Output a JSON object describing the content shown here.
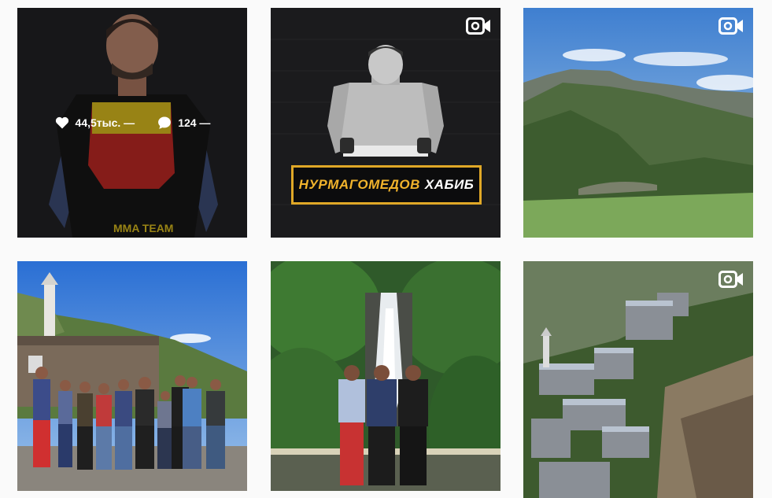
{
  "posts": [
    {
      "type": "photo",
      "hovered": true,
      "stats": {
        "likes": "44,5тыс. —",
        "comments": "124 —"
      }
    },
    {
      "type": "video",
      "banner": {
        "first": "НУРМАГОМЕДОВ",
        "last": "ХАБИБ"
      }
    },
    {
      "type": "video"
    },
    {
      "type": "photo"
    },
    {
      "type": "photo"
    },
    {
      "type": "video"
    }
  ],
  "icons": {
    "like": "heart-icon",
    "comment": "comment-bubble-icon",
    "video": "video-camera-icon"
  },
  "colors": {
    "accent_gold": "#e0a827",
    "overlay_text": "#ffffff",
    "background": "#fafafa"
  }
}
